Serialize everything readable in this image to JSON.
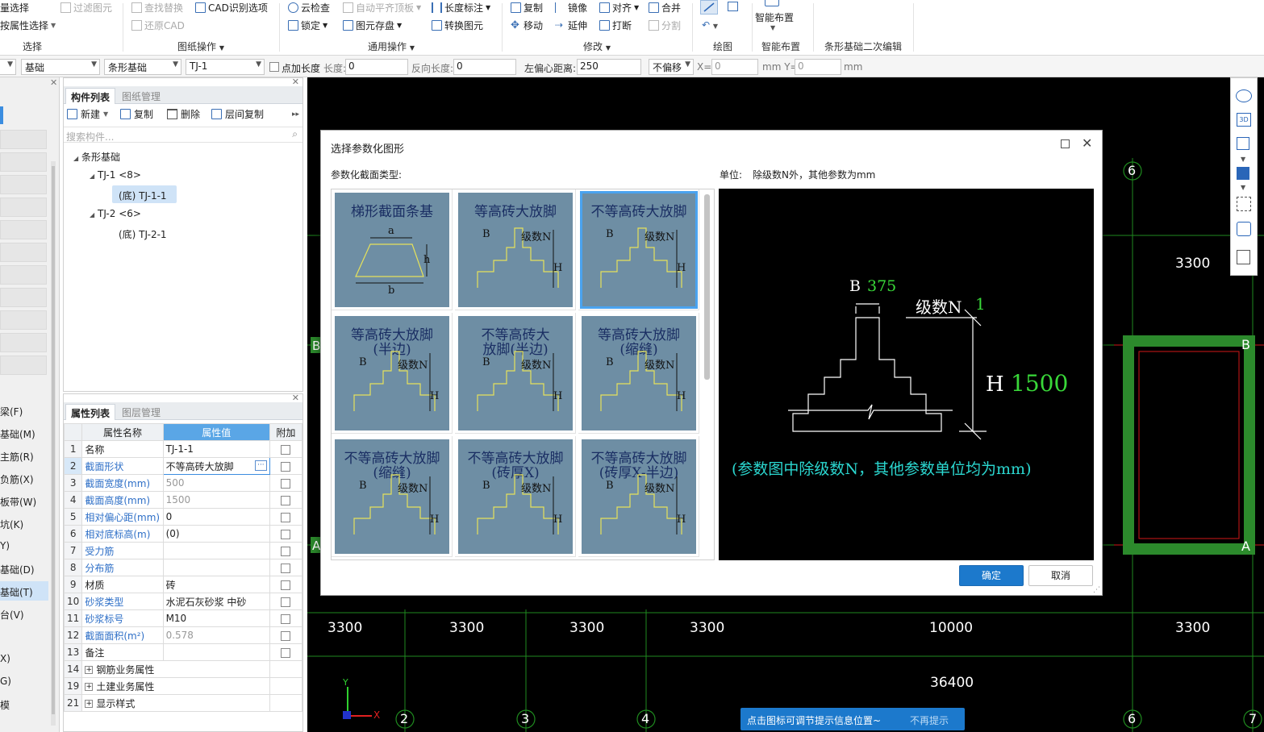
{
  "ribbon": {
    "select_items": [
      "量选择",
      "按属性选择"
    ],
    "select_group": "选择",
    "filter": "过滤图元",
    "find_replace": "查找替换",
    "cad_options": "CAD识别选项",
    "restore_cad": "还原CAD",
    "drawing_group": "图纸操作",
    "cloud_check": "云检查",
    "auto_align": "自动平齐顶板",
    "length_mark": "长度标注",
    "lock": "锁定",
    "save_elem": "图元存盘",
    "convert_elem": "转换图元",
    "common_group": "通用操作",
    "copy": "复制",
    "mirror": "镜像",
    "align": "对齐",
    "merge": "合并",
    "move": "移动",
    "extend": "延伸",
    "break": "打断",
    "split": "分割",
    "modify_group": "修改",
    "draw_group": "绘图",
    "smart_layout": "智能布置",
    "smart_group": "智能布置",
    "strip_edit_group": "条形基础二次编辑"
  },
  "options": {
    "floor": "基础",
    "type": "条形基础",
    "member": "TJ-1",
    "point_len": "点加长度",
    "len_label": "长度:",
    "len_val": "0",
    "rev_label": "反向长度:",
    "rev_val": "0",
    "offset_label": "左偏心距离:",
    "offset_val": "250",
    "shift": "不偏移",
    "x_label": "X=",
    "x_val": "0",
    "y_label": "mm Y=",
    "y_val": "0",
    "mm": "mm"
  },
  "leftnav": [
    "梁(F)",
    "基础(M)",
    "主筋(R)",
    "负筋(X)",
    "板带(W)",
    "坑(K)",
    "Y)",
    "基础(D)",
    "基础(T)",
    "台(V)",
    "X)",
    "G)",
    "模"
  ],
  "component_panel": {
    "tab_active": "构件列表",
    "tab_inactive": "图纸管理",
    "new": "新建",
    "copy": "复制",
    "delete": "删除",
    "layer_copy": "层间复制",
    "search_placeholder": "搜索构件...",
    "tree_root": "条形基础",
    "tj1": "TJ-1 <8>",
    "tj1_child": "(底) TJ-1-1",
    "tj2": "TJ-2 <6>",
    "tj2_child": "(底) TJ-2-1"
  },
  "property_panel": {
    "tab_active": "属性列表",
    "tab_inactive": "图层管理",
    "col_name": "属性名称",
    "col_value": "属性值",
    "col_extra": "附加",
    "rows": [
      {
        "n": "1",
        "name": "名称",
        "value": "TJ-1-1"
      },
      {
        "n": "2",
        "name": "截面形状",
        "value": "不等高砖大放脚"
      },
      {
        "n": "3",
        "name": "截面宽度(mm)",
        "value": "500"
      },
      {
        "n": "4",
        "name": "截面高度(mm)",
        "value": "1500"
      },
      {
        "n": "5",
        "name": "相对偏心距(mm)",
        "value": "0"
      },
      {
        "n": "6",
        "name": "相对底标高(m)",
        "value": "(0)"
      },
      {
        "n": "7",
        "name": "受力筋",
        "value": ""
      },
      {
        "n": "8",
        "name": "分布筋",
        "value": ""
      },
      {
        "n": "9",
        "name": "材质",
        "value": "砖"
      },
      {
        "n": "10",
        "name": "砂浆类型",
        "value": "水泥石灰砂浆 中砂"
      },
      {
        "n": "11",
        "name": "砂浆标号",
        "value": "M10"
      },
      {
        "n": "12",
        "name": "截面面积(m²)",
        "value": "0.578"
      },
      {
        "n": "13",
        "name": "备注",
        "value": ""
      }
    ],
    "groups": [
      {
        "n": "14",
        "name": "钢筋业务属性"
      },
      {
        "n": "19",
        "name": "土建业务属性"
      },
      {
        "n": "21",
        "name": "显示样式"
      }
    ]
  },
  "canvas": {
    "dims_top": [
      "3300"
    ],
    "dims_row": [
      "3300",
      "3300",
      "3300",
      "3300",
      "10000",
      "3300"
    ],
    "total": "36400",
    "axis_numbers": [
      "2",
      "3",
      "4",
      "6",
      "7",
      "6"
    ],
    "axis_letters": [
      "B",
      "A",
      "B",
      "A"
    ],
    "toast": "点击图标可调节提示信息位置~",
    "toast_dismiss": "不再提示"
  },
  "dialog": {
    "title": "选择参数化图形",
    "type_label": "参数化截面类型:",
    "unit_label": "单位:",
    "unit_text": "除级数N外，其他参数为mm",
    "thumbs": [
      {
        "title1": "梯形截面条基",
        "title2": ""
      },
      {
        "title1": "等高砖大放脚",
        "title2": ""
      },
      {
        "title1": "不等高砖大放脚",
        "title2": ""
      },
      {
        "title1": "等高砖大放脚",
        "title2": "(半边)"
      },
      {
        "title1": "不等高砖大",
        "title2": "放脚(半边)"
      },
      {
        "title1": "等高砖大放脚",
        "title2": "(缩缝)"
      },
      {
        "title1": "不等高砖大放脚",
        "title2": "(缩缝)"
      },
      {
        "title1": "不等高砖大放脚",
        "title2": "(砖厚X)"
      },
      {
        "title1": "不等高砖大放脚",
        "title2": "(砖厚X-半边)"
      }
    ],
    "preview": {
      "b_label": "B",
      "b_val": "375",
      "n_label": "级数N",
      "n_val": "1",
      "h_label": "H",
      "h_val": "1500",
      "note": "(参数图中除级数N，其他参数单位均为mm)"
    },
    "ok": "确定",
    "cancel": "取消"
  },
  "colors": {
    "accent": "#1c79cc",
    "grid": "#1f8a1f",
    "thumb_bg": "#6e8ea4",
    "preview_green": "#39d839",
    "preview_note": "#2bd7d0"
  }
}
